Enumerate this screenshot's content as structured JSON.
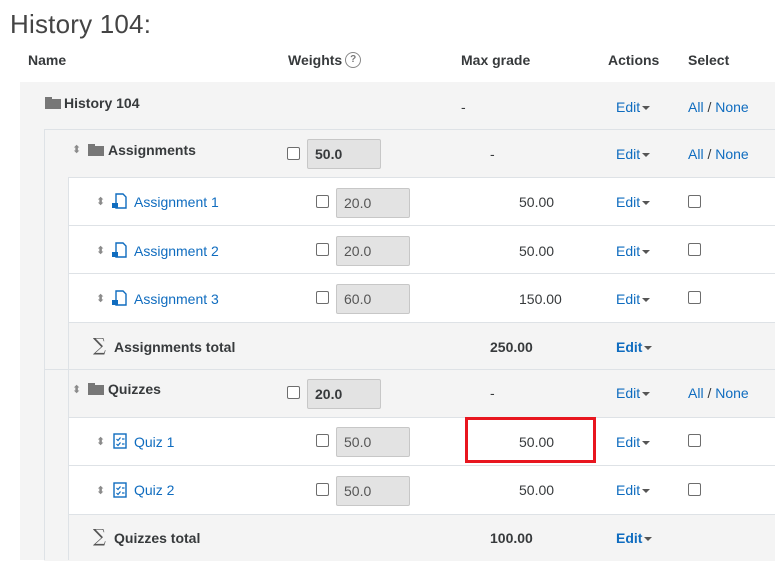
{
  "page": {
    "title": "History 104:"
  },
  "columns": {
    "name": "Name",
    "weights": "Weights",
    "weights_help": "?",
    "max_grade": "Max grade",
    "actions": "Actions",
    "select": "Select"
  },
  "course": {
    "name": "History 104",
    "max_grade": "-",
    "edit": "Edit",
    "select_all": "All",
    "select_sep": "/",
    "select_none": "None"
  },
  "assignments": {
    "name": "Assignments",
    "weight": "50.0",
    "max_grade": "-",
    "edit": "Edit",
    "select_all": "All",
    "select_sep": "/",
    "select_none": "None",
    "items": [
      {
        "name": "Assignment 1",
        "weight": "20.0",
        "max_grade": "50.00",
        "edit": "Edit"
      },
      {
        "name": "Assignment 2",
        "weight": "20.0",
        "max_grade": "50.00",
        "edit": "Edit"
      },
      {
        "name": "Assignment 3",
        "weight": "60.0",
        "max_grade": "150.00",
        "edit": "Edit"
      }
    ],
    "total_label": "Assignments total",
    "total_max": "250.00",
    "total_edit": "Edit"
  },
  "quizzes": {
    "name": "Quizzes",
    "weight": "20.0",
    "max_grade": "-",
    "edit": "Edit",
    "select_all": "All",
    "select_sep": "/",
    "select_none": "None",
    "items": [
      {
        "name": "Quiz 1",
        "weight": "50.0",
        "max_grade": "50.00",
        "edit": "Edit"
      },
      {
        "name": "Quiz 2",
        "weight": "50.0",
        "max_grade": "50.00",
        "edit": "Edit"
      }
    ],
    "total_label": "Quizzes total",
    "total_max": "100.00",
    "total_edit": "Edit"
  },
  "colors": {
    "link": "#0f6cbf",
    "highlight": "#e8161f",
    "band": "#f4f4f4"
  },
  "icons": {
    "folder": "folder-icon",
    "move": "move-icon",
    "assignment": "assignment-icon",
    "quiz": "quiz-icon",
    "sigma": "sigma-icon",
    "help": "help-icon",
    "caret": "caret-down-icon"
  }
}
